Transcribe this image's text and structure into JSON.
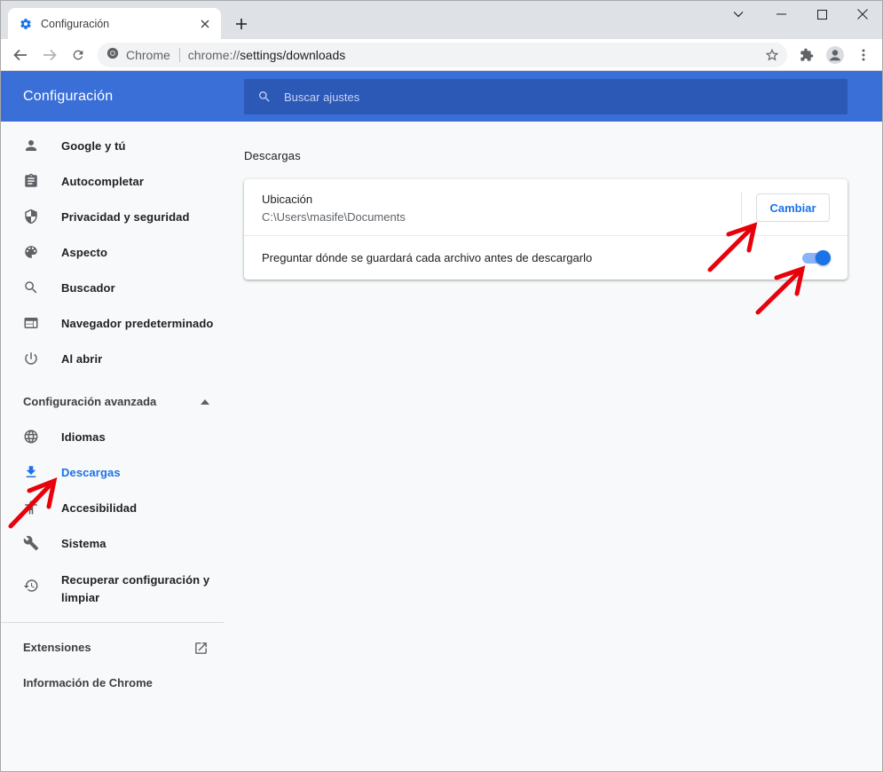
{
  "tab": {
    "title": "Configuración",
    "icon": "gear-icon"
  },
  "toolbar": {
    "site_label": "Chrome",
    "url_prefix": "chrome://",
    "url_rest": "settings/downloads"
  },
  "settings": {
    "title": "Configuración",
    "search_placeholder": "Buscar ajustes"
  },
  "sidebar": {
    "items": [
      {
        "label": "Google y tú",
        "icon": "person-icon"
      },
      {
        "label": "Autocompletar",
        "icon": "clipboard-icon"
      },
      {
        "label": "Privacidad y seguridad",
        "icon": "shield-icon"
      },
      {
        "label": "Aspecto",
        "icon": "palette-icon"
      },
      {
        "label": "Buscador",
        "icon": "search-icon"
      },
      {
        "label": "Navegador predeterminado",
        "icon": "browser-icon"
      },
      {
        "label": "Al abrir",
        "icon": "power-icon"
      }
    ],
    "advanced_label": "Configuración avanzada",
    "advanced_items": [
      {
        "label": "Idiomas",
        "icon": "globe-icon"
      },
      {
        "label": "Descargas",
        "icon": "download-icon",
        "active": true
      },
      {
        "label": "Accesibilidad",
        "icon": "accessibility-icon"
      },
      {
        "label": "Sistema",
        "icon": "wrench-icon"
      },
      {
        "label": "Recuperar configuración y limpiar",
        "icon": "restore-icon"
      }
    ],
    "extensions_label": "Extensiones",
    "about_label": "Información de Chrome"
  },
  "downloads": {
    "section_title": "Descargas",
    "location_label": "Ubicación",
    "location_path": "C:\\Users\\masife\\Documents",
    "change_button": "Cambiar",
    "ask_label": "Preguntar dónde se guardará cada archivo antes de descargarlo",
    "ask_enabled": true
  },
  "colors": {
    "header": "#3a6fd8",
    "accent": "#1a73e8",
    "annotation_arrow": "#e8000b"
  }
}
